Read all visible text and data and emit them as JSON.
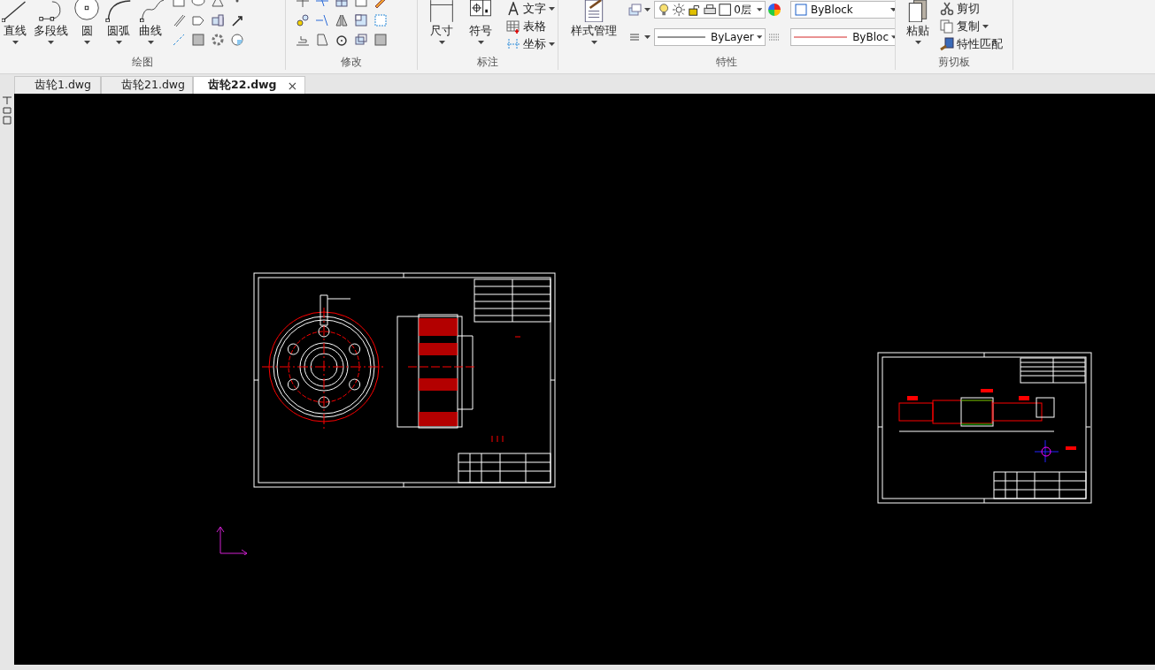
{
  "ribbon": {
    "panels": [
      {
        "kind": "draw",
        "title": "绘图",
        "large_buttons": [
          "直线",
          "多段线",
          "圆",
          "圆弧",
          "曲线"
        ]
      },
      {
        "kind": "modify",
        "title": "修改"
      },
      {
        "kind": "annotate",
        "title": "标注",
        "large_buttons": [
          "尺寸",
          "符号"
        ],
        "small_buttons": [
          "文字",
          "表格",
          "坐标"
        ]
      },
      {
        "kind": "properties",
        "title": "特性",
        "large_buttons": [
          "样式管理"
        ],
        "layer": "0层",
        "color_name": "ByBlock",
        "linetype": "ByLayer",
        "lineweight": "ByBloc"
      },
      {
        "kind": "clipboard",
        "title": "剪切板",
        "large_buttons": [
          "粘贴"
        ],
        "small_buttons": [
          "剪切",
          "复制",
          "特性匹配"
        ]
      }
    ]
  },
  "doc_tabs": [
    {
      "label": "齿轮1.dwg",
      "selected": false
    },
    {
      "label": "齿轮21.dwg",
      "selected": false
    },
    {
      "label": "齿轮22.dwg",
      "selected": true
    }
  ],
  "close_mark": "×"
}
